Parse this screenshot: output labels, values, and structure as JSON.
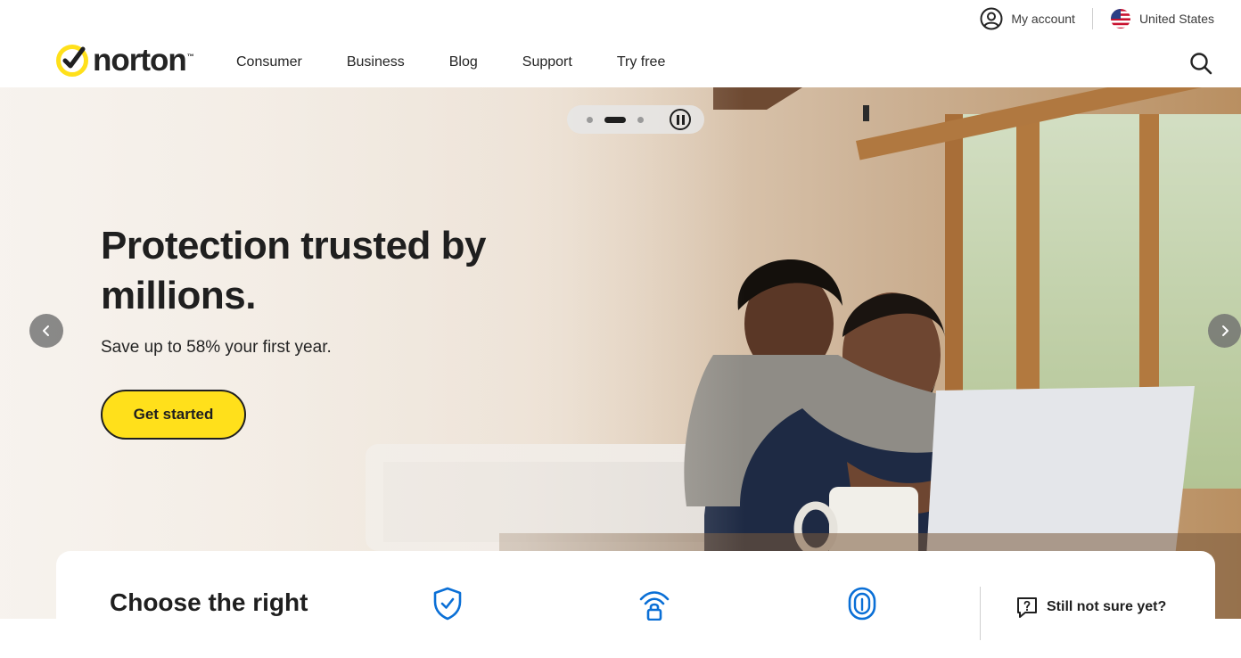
{
  "utility_bar": {
    "account_label": "My account",
    "region_label": "United States"
  },
  "nav": {
    "logo_text": "norton",
    "logo_tm": "™",
    "links": [
      "Consumer",
      "Business",
      "Blog",
      "Support",
      "Try free"
    ]
  },
  "hero": {
    "title": "Protection trusted by millions.",
    "subtitle": "Save up to 58% your first year.",
    "cta_label": "Get started",
    "carousel": {
      "slide_count": 3,
      "active_slide": 2
    }
  },
  "choose_section": {
    "title": "Choose the right",
    "help_label": "Still not sure yet?",
    "feature_icons": [
      "shield-check-icon",
      "wifi-lock-icon",
      "fingerprint-icon"
    ]
  },
  "colors": {
    "accent_yellow": "#ffe01b",
    "icon_blue": "#0a6fd6",
    "text_dark": "#242424"
  }
}
